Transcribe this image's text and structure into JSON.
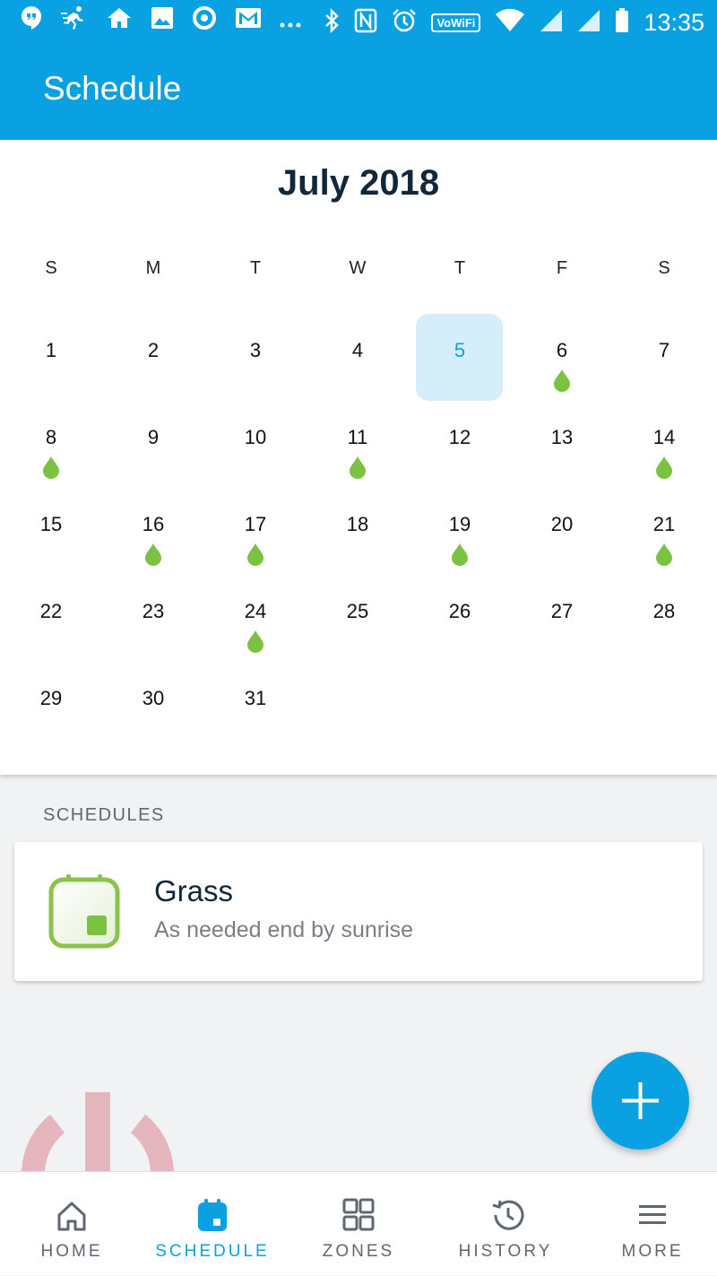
{
  "status_bar": {
    "time": "13:35",
    "wifi_badge": "VoWiFi",
    "left_icons": [
      "hangouts-icon",
      "activity-icon",
      "home-icon",
      "gallery-icon",
      "circle-app-icon",
      "gmail-icon",
      "more-dots-icon"
    ],
    "right_icons": [
      "bluetooth-icon",
      "nfc-icon",
      "alarm-icon",
      "vowifi-icon",
      "wifi-icon",
      "signal-icon",
      "signal-roaming-icon",
      "battery-icon"
    ]
  },
  "app_bar": {
    "title": "Schedule"
  },
  "calendar": {
    "month_title": "July 2018",
    "weekdays": [
      "S",
      "M",
      "T",
      "W",
      "T",
      "F",
      "S"
    ],
    "selected_day": 5,
    "weeks": [
      [
        {
          "day": "1"
        },
        {
          "day": "2"
        },
        {
          "day": "3"
        },
        {
          "day": "4"
        },
        {
          "day": "5",
          "selected": true
        },
        {
          "day": "6",
          "water": true
        },
        {
          "day": "7"
        }
      ],
      [
        {
          "day": "8",
          "water": true
        },
        {
          "day": "9"
        },
        {
          "day": "10"
        },
        {
          "day": "11",
          "water": true
        },
        {
          "day": "12"
        },
        {
          "day": "13"
        },
        {
          "day": "14",
          "water": true
        }
      ],
      [
        {
          "day": "15"
        },
        {
          "day": "16",
          "water": true
        },
        {
          "day": "17",
          "water": true
        },
        {
          "day": "18"
        },
        {
          "day": "19",
          "water": true
        },
        {
          "day": "20"
        },
        {
          "day": "21",
          "water": true
        }
      ],
      [
        {
          "day": "22"
        },
        {
          "day": "23"
        },
        {
          "day": "24",
          "water": true
        },
        {
          "day": "25"
        },
        {
          "day": "26"
        },
        {
          "day": "27"
        },
        {
          "day": "28"
        }
      ],
      [
        {
          "day": "29"
        },
        {
          "day": "30"
        },
        {
          "day": "31"
        }
      ]
    ]
  },
  "schedules": {
    "section_label": "SCHEDULES",
    "items": [
      {
        "name": "Grass",
        "description": "As needed end by sunrise",
        "icon": "calendar-schedule-icon"
      }
    ]
  },
  "fab": {
    "icon": "plus-icon"
  },
  "bottom_nav": {
    "items": [
      {
        "label": "HOME",
        "icon": "home-icon",
        "active": false
      },
      {
        "label": "SCHEDULE",
        "icon": "calendar-icon",
        "active": true
      },
      {
        "label": "ZONES",
        "icon": "grid-icon",
        "active": false
      },
      {
        "label": "HISTORY",
        "icon": "history-icon",
        "active": false
      },
      {
        "label": "MORE",
        "icon": "menu-icon",
        "active": false
      }
    ]
  },
  "colors": {
    "primary": "#0aa1e3",
    "water_drop": "#7cc242",
    "selected_day_bg": "#d6eefa",
    "schedule_icon_green": "#8bc34a",
    "watermark": "#e0949f"
  }
}
